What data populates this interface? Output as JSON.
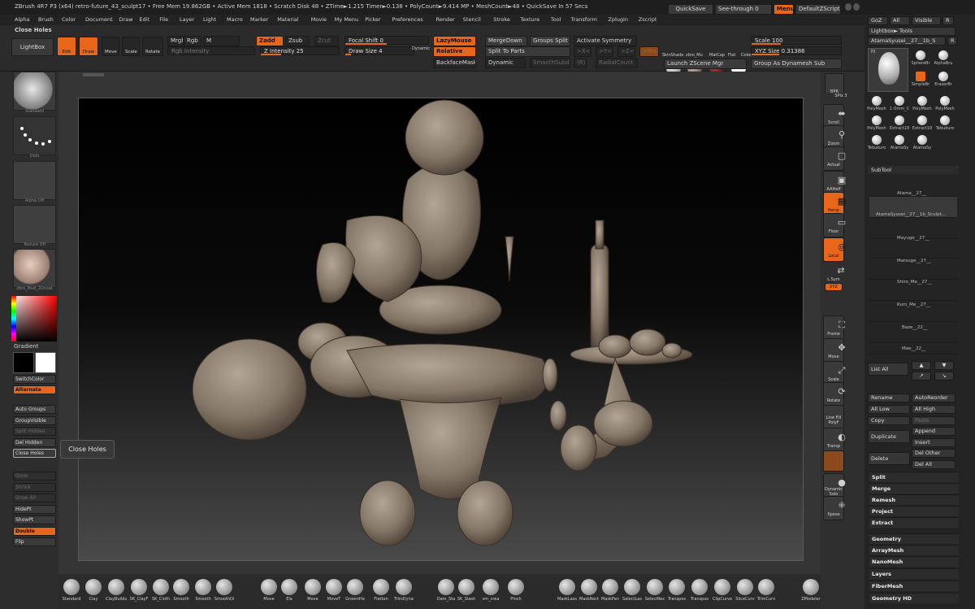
{
  "title_bar": {
    "text": "ZBrush 4R7 P3 (x64)  retro-future_43_sculpt17   • Free Mem 19.862GB • Active Mem 1818 • Scratch Disk 48 • ZTime►1.215 Timer►0.138 • PolyCount►9.414 MP • MeshCount►48 • QuickSave In 57 Secs",
    "quicksave": "QuickSave",
    "see_through": "See-through  0",
    "menus": "Menus",
    "default_zscript": "DefaultZScript"
  },
  "menu_bar": [
    "Alpha",
    "Brush",
    "Color",
    "Document",
    "Draw",
    "Edit",
    "File",
    "Layer",
    "Light",
    "Macro",
    "Marker",
    "Material",
    "Movie",
    "My Menu",
    "Picker",
    "Preferences",
    "Render",
    "Stencil",
    "Stroke",
    "Texture",
    "Tool",
    "Transform",
    "Zplugin",
    "Zscript"
  ],
  "shelf": {
    "close_holes_title": "Close Holes",
    "lightbox": "LightBox",
    "edit": "Edit",
    "draw": "Draw",
    "move": "Move",
    "scale": "Scale",
    "rotate": "Rotate",
    "mrgb": "Mrgb",
    "rgb": "Rgb",
    "m": "M",
    "rgb_intensity": "Rgb Intensity",
    "zadd": "Zadd",
    "zsub": "Zsub",
    "zcut": "Zcut",
    "z_intensity": "Z Intensity 25",
    "focal_shift": "Focal Shift 0",
    "draw_size": "Draw Size 4",
    "dynamic": "Dynamic",
    "lazy_mouse": "LazyMouse",
    "relative": "Relative",
    "backface_mask": "BackfaceMask",
    "merge_down": "MergeDown",
    "groups_split": "Groups Split",
    "activate_symmetry": "Activate Symmetry",
    "split_to_parts": "Split To Parts",
    "dynamic2": "Dynamic",
    "smooth_subdiv": "SmoothSubdiv",
    "r_label": "(R)",
    "radial_count": "RadialCount",
    "x": ">X<",
    "y": ">Y<",
    "z": ">Z<",
    "m2": ">M<",
    "materials": [
      "SkinShade",
      "zbro_Mu",
      "MatCap",
      "Flat",
      "Color"
    ],
    "scale_val": "Scale 100",
    "xyz_size": "XYZ Size 0.31386",
    "launch_zscene": "Launch ZScene Mgr",
    "group_as_dynamesh": "Group As Dynamesh Sub"
  },
  "left_tray": {
    "standard": "Standard",
    "dots": "Dots",
    "alpha_off": "Alpha Off",
    "texture_off": "Texture Off",
    "material": "zbro_Mud_2Dcoat",
    "gradient": "Gradient",
    "switch_color": "SwitchColor",
    "alternate": "Alternate",
    "auto_groups": "Auto Groups",
    "group_visible": "GroupVisible",
    "split_hidden": "Split Hidden",
    "del_hidden": "Del Hidden",
    "close_holes": "Close Holes",
    "grow": "Grow",
    "shrink": "Shrink",
    "grow_all": "Grow All",
    "hide_pt": "HidePt",
    "show_pt": "ShowPt",
    "double": "Double",
    "flip": "Flip"
  },
  "tooltip": "Close Holes",
  "right_tray": [
    "BPR",
    "SPix 3",
    "Scroll",
    "Zoom",
    "Actual",
    "AAHalf",
    "Persp",
    "Floor",
    "Local",
    "L.Sym",
    "XYZ",
    "Frame",
    "Move",
    "Scale",
    "Rotate",
    "Line Fill PolyF",
    "Transp",
    "Dynamic Solo",
    "Xpose"
  ],
  "tool_panel": {
    "goz": "GoZ",
    "all": "All",
    "visible": "Visible",
    "r": "R",
    "lightbox_tools": "Lightbox► Tools",
    "current_tool": "AtamaSyusei__27__1b_S",
    "r2": "R",
    "tool_count": "70",
    "tools": [
      "SphereBr",
      "AlphaBru",
      "SimpleBr",
      "EraserBr",
      "PolyMesh",
      "1 Omm_C",
      "PolyMesh",
      "PolyMesh",
      "PolyMesh",
      "Extract18",
      "Extract18",
      "Tebukuro",
      "Tebukuro",
      "AtamaSy",
      "AtamaSy"
    ],
    "subtool_title": "SubTool",
    "subtools": [
      "",
      "Atama__27__",
      "AtamaSyusei__27__1b_Sculpt...",
      "",
      "Mayuge__27__",
      "Matsuge__27__",
      "Shiro_Me__27__",
      "Kuro_Me__27__",
      "Baze__22__",
      "Mae__22__"
    ],
    "list_all": "List All",
    "rename": "Rename",
    "auto_reorder": "AutoReorder",
    "all_low": "All Low",
    "all_high": "All High",
    "copy": "Copy",
    "paste": "Paste",
    "append": "Append",
    "duplicate": "Duplicate",
    "insert": "Insert",
    "delete": "Delete",
    "del_other": "Del Other",
    "del_all": "Del All",
    "split": "Split",
    "merge": "Merge",
    "remesh": "Remesh",
    "project": "Project",
    "extract": "Extract",
    "sections": [
      "Geometry",
      "ArrayMesh",
      "NanoMesh",
      "Layers",
      "FiberMesh",
      "Geometry HD"
    ]
  },
  "brushes": [
    "Standard",
    "Clay",
    "ClayBuildup",
    "SK_ClayF",
    "SK_Cloth",
    "Smooth",
    "Smooth",
    "SmoothDi",
    "Move",
    "Ela",
    "Move",
    "MoveT",
    "GroomHa",
    "Flatten",
    "TrimDyna",
    "Dam_Sta",
    "SK_Slash",
    "sm_crea",
    "Pinch",
    "MaskLass",
    "MaskRect",
    "MaskPen",
    "SelectLas",
    "SelectRec",
    "Transpos",
    "Transpos",
    "ClipCurve",
    "SliceCurv",
    "TrimCurv",
    "ZModeler"
  ],
  "colors": {
    "accent": "#e8661a",
    "bg": "#2a2a2a",
    "sculpt": "#8c7f74"
  }
}
